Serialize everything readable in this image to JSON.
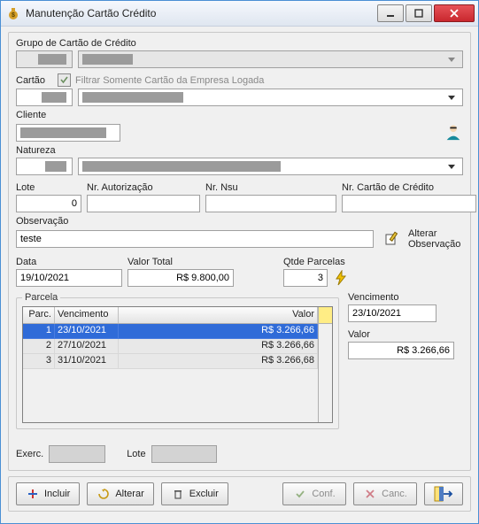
{
  "window": {
    "title": "Manutenção Cartão Crédito"
  },
  "labels": {
    "grupo": "Grupo de Cartão de Crédito",
    "cartao": "Cartão",
    "filtrar": "Filtrar Somente Cartão da Empresa Logada",
    "cliente": "Cliente",
    "natureza": "Natureza",
    "lote": "Lote",
    "nrAut": "Nr. Autorização",
    "nrNsu": "Nr. Nsu",
    "nrCartao": "Nr. Cartão de Crédito",
    "obs": "Observação",
    "alterarObs": "Alterar Observação",
    "data": "Data",
    "valorTotal": "Valor Total",
    "qtdeParc": "Qtde Parcelas",
    "parcela": "Parcela",
    "vencimento": "Vencimento",
    "valor": "Valor",
    "exerc": "Exerc.",
    "footerLote": "Lote"
  },
  "fields": {
    "lote": "0",
    "nrAut": "",
    "nrNsu": "",
    "nrCartao": "",
    "obs": "teste",
    "data": "19/10/2021",
    "valorTotal": "R$ 9.800,00",
    "qtdeParcelas": "3",
    "selVenc": "23/10/2021",
    "selValor": "R$ 3.266,66",
    "exerc": "",
    "footerLote": ""
  },
  "gridHeaders": {
    "parc": "Parc.",
    "venc": "Vencimento",
    "valor": "Valor"
  },
  "rows": [
    {
      "parc": "1",
      "venc": "23/10/2021",
      "valor": "R$ 3.266,66"
    },
    {
      "parc": "2",
      "venc": "27/10/2021",
      "valor": "R$ 3.266,66"
    },
    {
      "parc": "3",
      "venc": "31/10/2021",
      "valor": "R$ 3.266,68"
    }
  ],
  "buttons": {
    "incluir": "Incluir",
    "alterar": "Alterar",
    "excluir": "Excluir",
    "conf": "Conf.",
    "canc": "Canc."
  }
}
